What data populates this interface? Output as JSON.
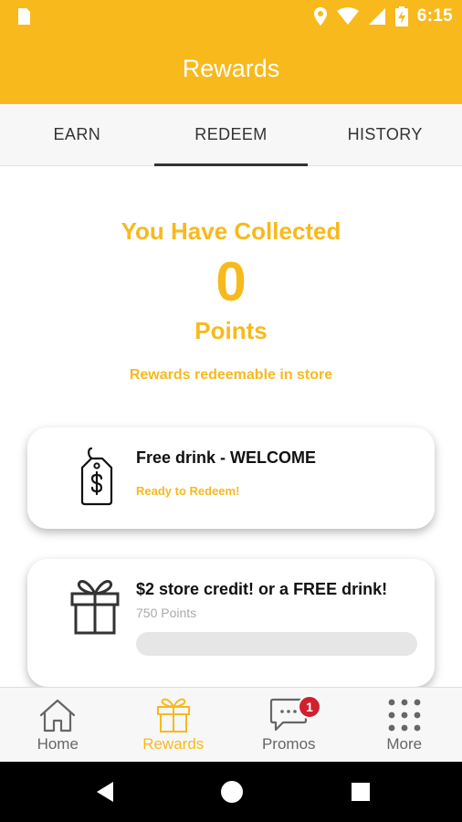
{
  "status_bar": {
    "time": "6:15",
    "icons": [
      "sim-card-icon",
      "location-pin-icon",
      "wifi-icon",
      "cell-signal-icon",
      "battery-charging-icon"
    ]
  },
  "app_bar": {
    "title": "Rewards"
  },
  "tabs": [
    {
      "label": "EARN",
      "active": false
    },
    {
      "label": "REDEEM",
      "active": true
    },
    {
      "label": "HISTORY",
      "active": false
    }
  ],
  "summary": {
    "heading": "You Have Collected",
    "points": "0",
    "points_label": "Points",
    "note": "Rewards redeemable in store"
  },
  "rewards": [
    {
      "icon": "price-tag-icon",
      "title": "Free drink - WELCOME",
      "status": "Ready to Redeem!"
    },
    {
      "icon": "gift-icon",
      "title": "$2 store credit! or a FREE drink!",
      "points_required": "750 Points",
      "progress": 0
    }
  ],
  "bottom_nav": [
    {
      "label": "Home",
      "icon": "home-icon",
      "active": false
    },
    {
      "label": "Rewards",
      "icon": "gift-icon",
      "active": true
    },
    {
      "label": "Promos",
      "icon": "chat-bubble-icon",
      "active": false,
      "badge": "1"
    },
    {
      "label": "More",
      "icon": "grid-dots-icon",
      "active": false
    }
  ],
  "colors": {
    "accent": "#F8B91C",
    "badge": "#D0202E",
    "text": "#333333"
  }
}
